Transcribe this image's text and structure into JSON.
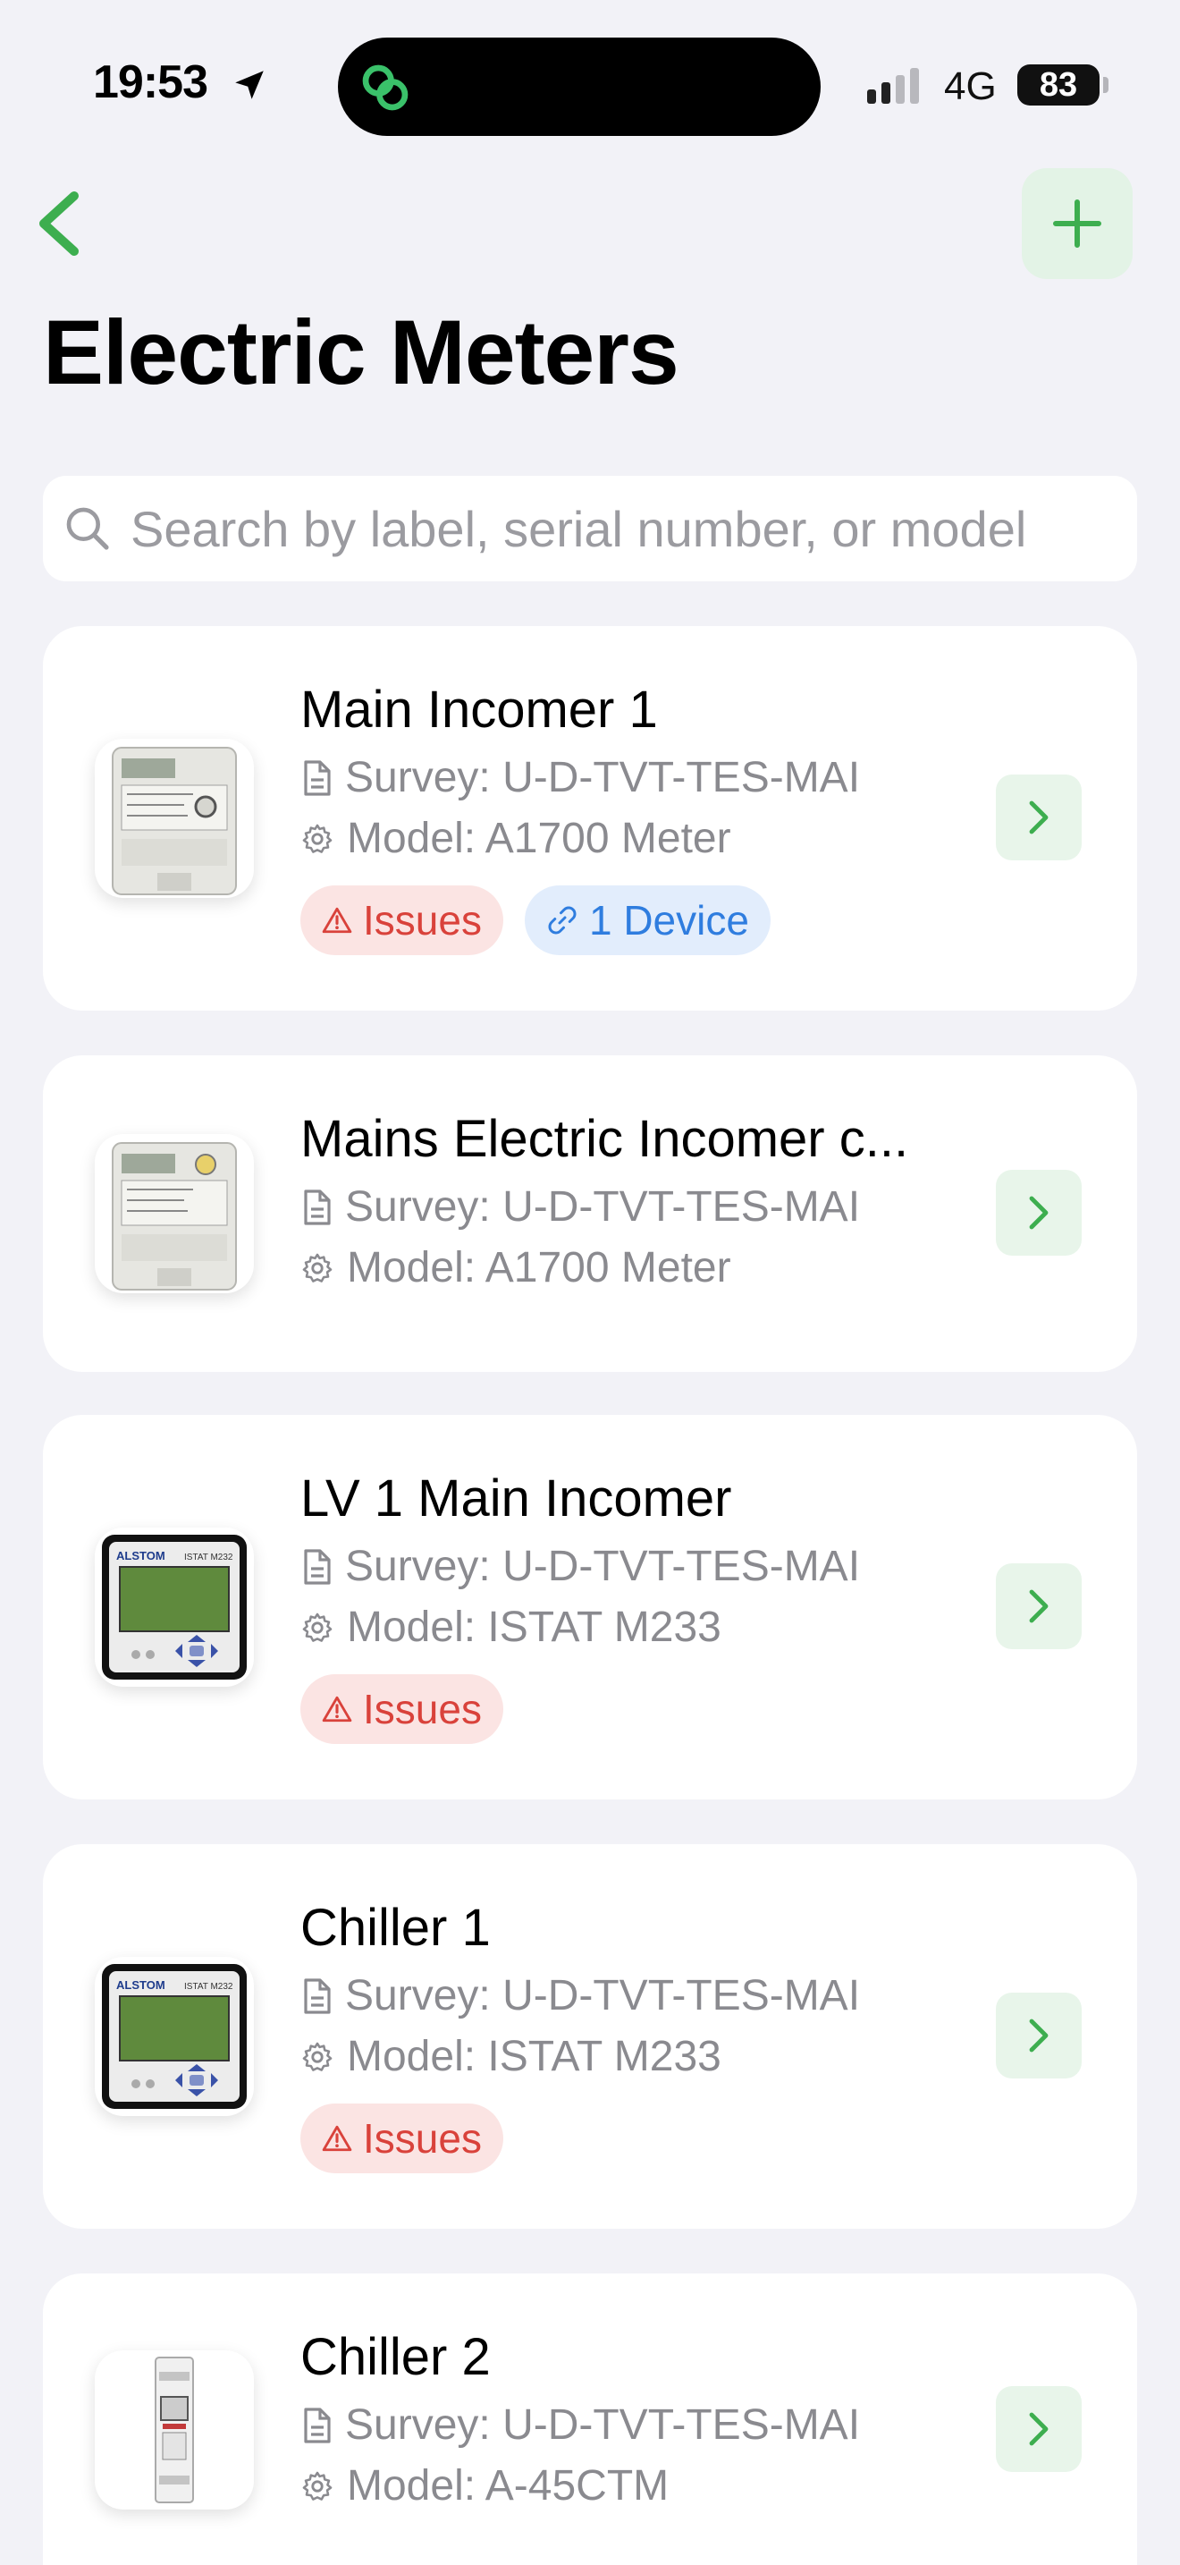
{
  "status_bar": {
    "time": "19:53",
    "network": "4G",
    "battery": "83"
  },
  "header": {
    "title": "Electric Meters"
  },
  "search": {
    "placeholder": "Search by label, serial number, or model"
  },
  "meters": [
    {
      "title": "Main Incomer 1",
      "survey": "Survey: U-D-TVT-TES-MAI",
      "model": "Model: A1700 Meter",
      "issues": "Issues",
      "devices": "1 Device",
      "thumb": "a1700-meter-image"
    },
    {
      "title": "Mains Electric Incomer c...",
      "survey": "Survey: U-D-TVT-TES-MAI",
      "model": "Model: A1700 Meter",
      "thumb": "a1700-meter-image"
    },
    {
      "title": "LV 1 Main Incomer",
      "survey": "Survey: U-D-TVT-TES-MAI",
      "model": "Model: ISTAT M233",
      "issues": "Issues",
      "thumb": "istat-meter-image"
    },
    {
      "title": "Chiller 1",
      "survey": "Survey: U-D-TVT-TES-MAI",
      "model": "Model: ISTAT M233",
      "issues": "Issues",
      "thumb": "istat-meter-image"
    },
    {
      "title": "Chiller 2",
      "survey": "Survey: U-D-TVT-TES-MAI",
      "model": "Model: A-45CTM",
      "thumb": "din-rail-meter-image"
    }
  ],
  "meter_thumb_text": {
    "istat_brand": "ALSTOM",
    "istat_model": "ISTAT M232"
  },
  "colors": {
    "accent_green": "#3dae4f",
    "issues_red": "#d9423b",
    "device_blue": "#2f7ddf",
    "background": "#f2f2f7"
  }
}
